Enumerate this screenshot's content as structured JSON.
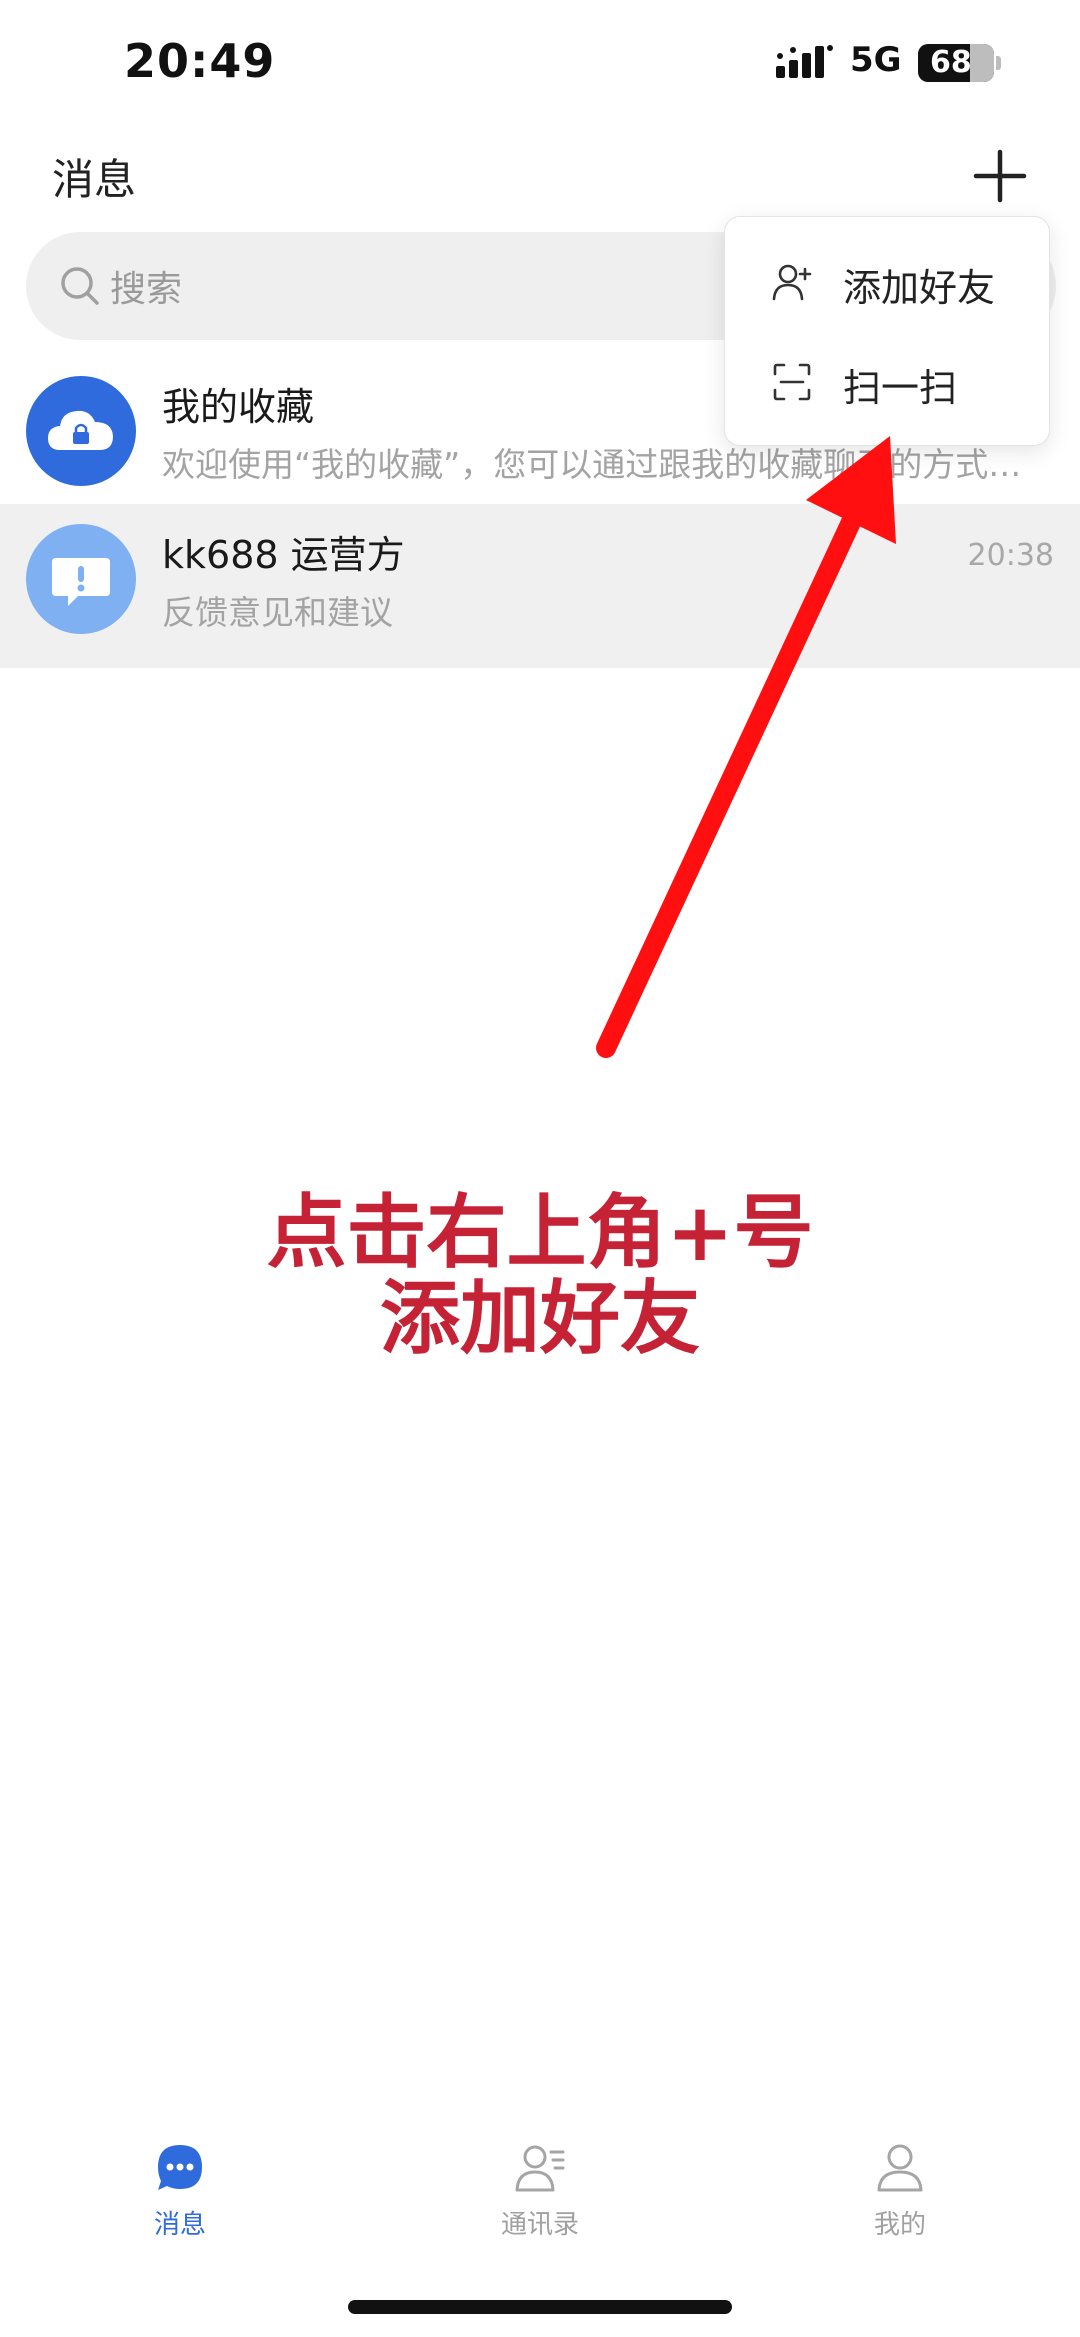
{
  "status_bar": {
    "time": "20:49",
    "network": "5G",
    "battery": "68"
  },
  "header": {
    "title": "消息",
    "plus_icon": "plus-icon"
  },
  "search": {
    "placeholder": "搜索",
    "icon": "search-icon"
  },
  "chats": [
    {
      "name": "我的收藏",
      "preview": "欢迎使用“我的收藏”，您可以通过跟我的收藏聊天的方式…",
      "time": "",
      "avatar_color": "#2f6bdc",
      "avatar_icon": "cloud-lock-icon"
    },
    {
      "name": "kk688 运营方",
      "preview": "反馈意见和建议",
      "time": "20:38",
      "avatar_color": "#7fb0f2",
      "avatar_icon": "feedback-icon"
    }
  ],
  "menu": {
    "items": [
      {
        "label": "添加好友",
        "icon": "add-friend-icon"
      },
      {
        "label": "扫一扫",
        "icon": "scan-icon"
      }
    ]
  },
  "annotation": {
    "line1": "点击右上角+号",
    "line2": "添加好友",
    "color": "#c62236",
    "arrow_color": "#ff0000"
  },
  "bottom_nav": {
    "items": [
      {
        "label": "消息",
        "icon": "messages-icon",
        "active": true
      },
      {
        "label": "通讯录",
        "icon": "contacts-icon",
        "active": false
      },
      {
        "label": "我的",
        "icon": "profile-icon",
        "active": false
      }
    ],
    "active_color": "#2f6bdc",
    "inactive_color": "#a0a0a0"
  }
}
